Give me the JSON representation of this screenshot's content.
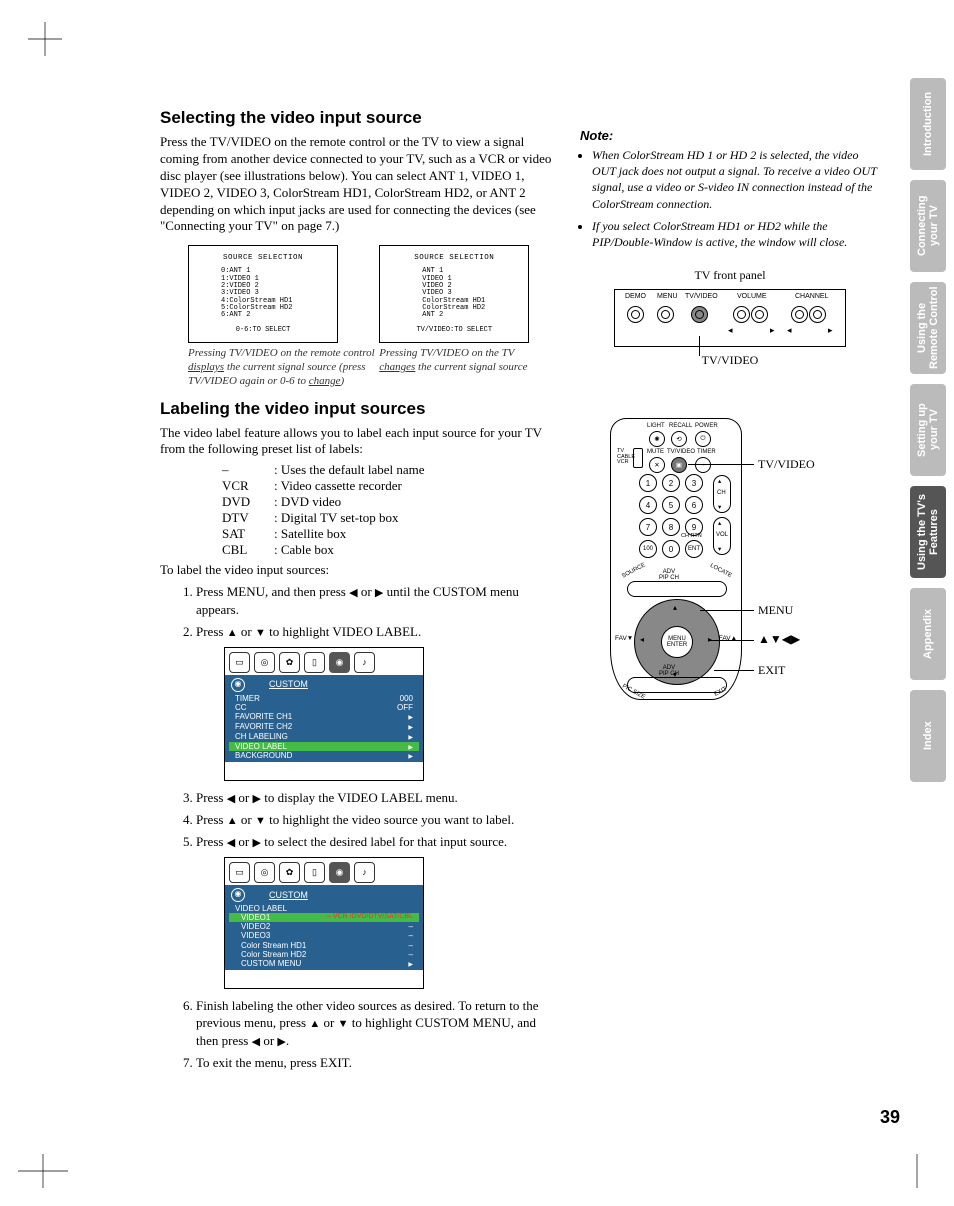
{
  "headings": {
    "h1": "Selecting the video input source",
    "h2": "Labeling the video input sources"
  },
  "body": {
    "intro": "Press the TV/VIDEO on the remote control or the TV to view a signal coming from another device connected to your TV, such as a VCR or video disc player (see illustrations below). You can select ANT 1, VIDEO 1, VIDEO 2, VIDEO 3, ColorStream HD1, ColorStream HD2, or ANT 2 depending on which input jacks are used for connecting the devices (see \"Connecting your TV\" on page 7.)",
    "labeling_intro": "The video label feature allows you to label each input source for your TV from the following preset list of labels:",
    "to_label": "To label the video input sources:"
  },
  "osd": {
    "title": "SOURCE SELECTION",
    "list_left": "0:ANT 1\n1:VIDEO 1\n2:VIDEO 2\n3:VIDEO 3\n4:ColorStream HD1\n5:ColorStream HD2\n6:ANT 2",
    "foot_left": "0-6:TO SELECT",
    "list_right": "ANT 1\nVIDEO 1\nVIDEO 2\nVIDEO 3\nColorStream HD1\nColorStream HD2\nANT 2",
    "foot_right": "TV/VIDEO:TO SELECT"
  },
  "captions": {
    "left1": "Pressing TV/VIDEO on the remote control ",
    "left_u1": "displays",
    "left2": " the current signal source (press TV/VIDEO again or 0-6 to ",
    "left_u2": "change",
    "left3": ")",
    "right1": "Pressing TV/VIDEO on the TV ",
    "right_u": "changes",
    "right2": " the current signal source"
  },
  "labels": {
    "dash": "–",
    "dash_desc": ": Uses the default label name",
    "vcr": "VCR",
    "vcr_desc": ": Video cassette recorder",
    "dvd": "DVD",
    "dvd_desc": ": DVD video",
    "dtv": "DTV",
    "dtv_desc": ": Digital TV set-top box",
    "sat": "SAT",
    "sat_desc": ": Satellite box",
    "cbl": "CBL",
    "cbl_desc": ": Cable box"
  },
  "steps": {
    "s1a": "Press MENU, and then press ",
    "s1b": " or ",
    "s1c": " until the CUSTOM menu appears.",
    "s2a": "Press ",
    "s2b": " or ",
    "s2c": " to highlight VIDEO LABEL.",
    "s3a": "Press ",
    "s3b": " or ",
    "s3c": " to display the VIDEO LABEL menu.",
    "s4a": "Press ",
    "s4b": " or ",
    "s4c": " to highlight the video source you want to label.",
    "s5a": "Press ",
    "s5b": " or ",
    "s5c": " to select the desired label for that input source.",
    "s6a": "Finish labeling the other video sources as desired. To return to the previous menu, press ",
    "s6b": " or ",
    "s6c": " to highlight CUSTOM MENU, and then press ",
    "s6d": " or ",
    "s6e": ".",
    "s7": "To exit the menu, press EXIT."
  },
  "menu1": {
    "title": "CUSTOM",
    "rows": [
      {
        "l": "TIMER",
        "r": "000"
      },
      {
        "l": "CC",
        "r": "OFF"
      },
      {
        "l": "FAVORITE CH1",
        "r": ""
      },
      {
        "l": "FAVORITE CH2",
        "r": ""
      },
      {
        "l": "CH LABELING",
        "r": ""
      },
      {
        "l": "VIDEO LABEL",
        "r": "",
        "hl": true
      },
      {
        "l": "BACKGROUND",
        "r": ""
      }
    ]
  },
  "menu2": {
    "title": "CUSTOM",
    "header": "VIDEO LABEL",
    "values": "– VCR /DVD/DTV/SAT/CBL",
    "rows": [
      {
        "l": "VIDEO1",
        "hl": true
      },
      {
        "l": "VIDEO2"
      },
      {
        "l": "VIDEO3"
      },
      {
        "l": "Color Stream HD1"
      },
      {
        "l": "Color Stream HD2"
      },
      {
        "l": "CUSTOM MENU"
      }
    ]
  },
  "note": {
    "head": "Note:",
    "n1": "When ColorStream HD 1 or HD 2 is selected, the video OUT jack does not output a signal. To receive a video OUT signal, use a video or S-video IN connection instead of the ColorStream connection.",
    "n2": "If you select ColorStream HD1 or HD2 while the PIP/Double-Window is active, the window will close."
  },
  "panel": {
    "title": "TV front panel",
    "caption": "TV/VIDEO",
    "btns": [
      "DEMO",
      "MENU",
      "TV/VIDEO",
      "VOLUME",
      "CHANNEL"
    ]
  },
  "remote": {
    "l_tvvideo": "TV/VIDEO",
    "l_menu": "MENU",
    "l_arrows": "▲▼◀▶",
    "l_exit": "EXIT",
    "small": {
      "light": "LIGHT",
      "recall": "RECALL",
      "power": "POWER",
      "sw": "TV\nCABLE\nVCR",
      "mute": "MUTE",
      "tvvideo": "TV/VIDEO",
      "timer": "TIMER",
      "ch": "CH",
      "vol": "VOL",
      "chrtn": "CH RTN",
      "fav_down": "FAV▼",
      "fav_up": "FAV▲",
      "menu": "MENU\nENTER",
      "adv_top": "ADV\nPIP CH",
      "adv_bot": "ADV\nPIP CH",
      "picsize": "PIC SIZE",
      "exit": "EXIT",
      "source": "SOURCE",
      "locate": "LOCATE"
    }
  },
  "tabs": {
    "t1": "Introduction",
    "t2": "Connecting\nyour TV",
    "t3": "Using the\nRemote Control",
    "t4": "Setting up\nyour TV",
    "t5": "Using the TV's\nFeatures",
    "t6": "Appendix",
    "t7": "Index"
  },
  "page_number": "39",
  "glyphs": {
    "up": "▲",
    "down": "▼",
    "left": "◀",
    "right": "▶"
  }
}
